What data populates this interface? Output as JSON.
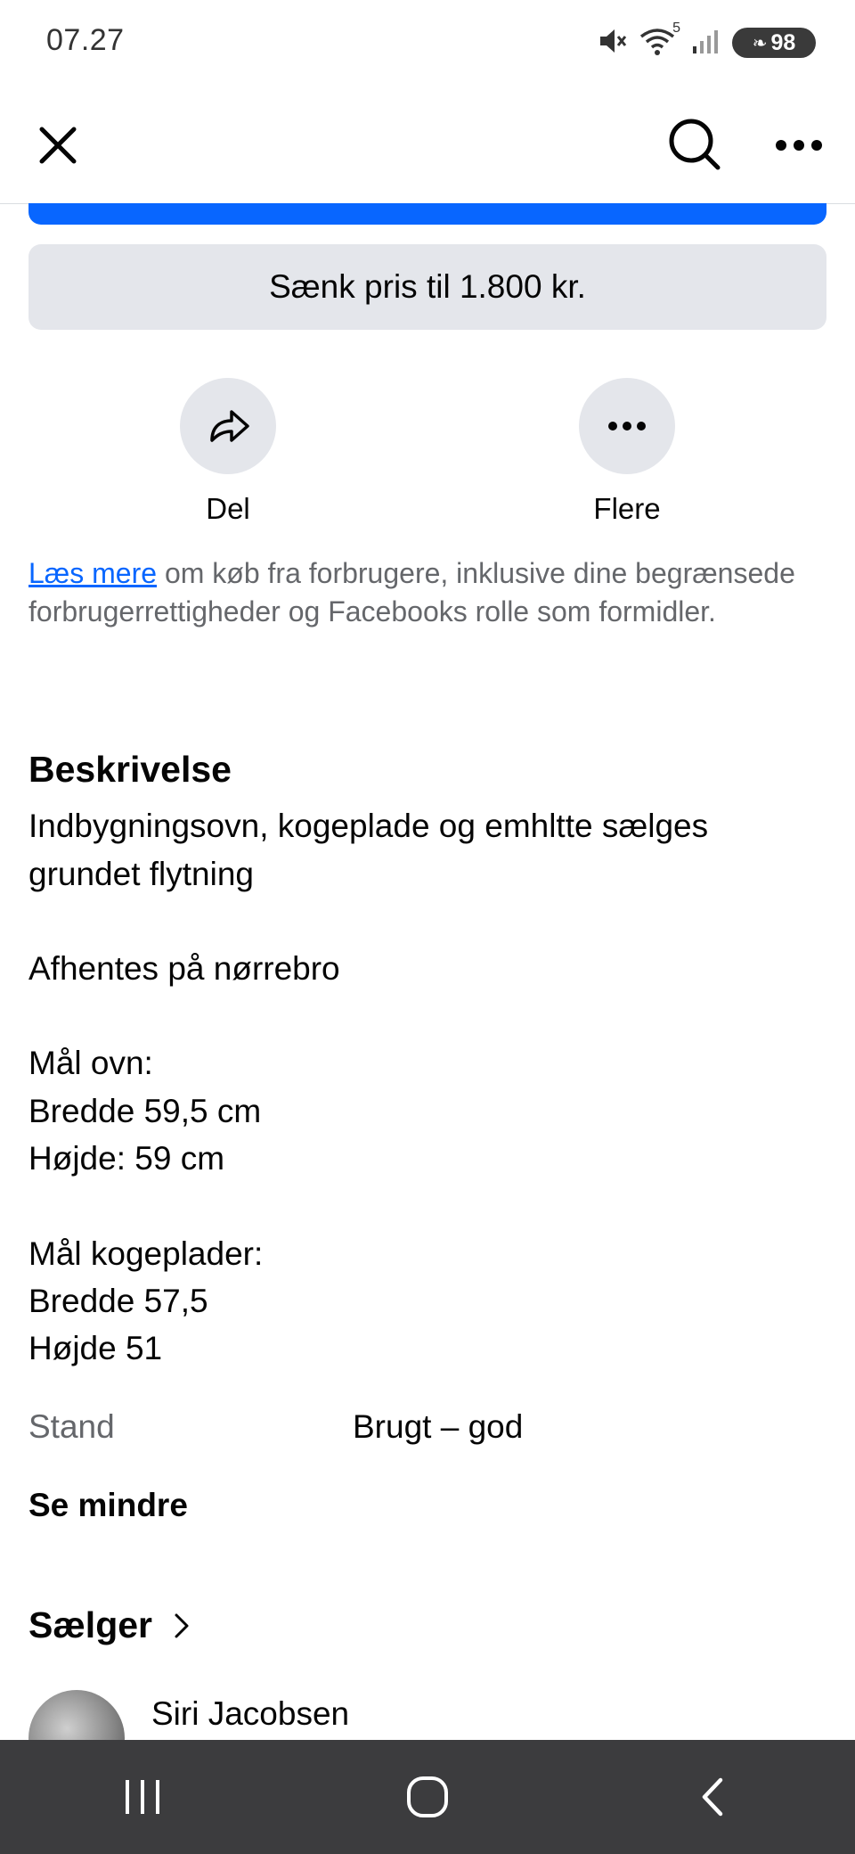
{
  "status_bar": {
    "time": "07.27",
    "battery": "98",
    "wifi_badge": "5"
  },
  "top_nav": {
    "close_icon": "close-icon",
    "search_icon": "search-icon",
    "more_icon": "more-horizontal-icon"
  },
  "actions": {
    "lower_price_label": "Sænk pris til 1.800 kr.",
    "share_label": "Del",
    "more_label": "Flere"
  },
  "legal": {
    "link_text": "Læs mere",
    "text": " om køb fra forbrugere, inklusive dine begrænsede forbrugerrettigheder og Facebooks rolle som formidler."
  },
  "description": {
    "heading": "Beskrivelse",
    "lines": [
      "Indbygningsovn, kogeplade og emhltte sælges",
      "grundet flytning",
      "Afhentes på nørrebro",
      "Mål ovn:",
      "Bredde 59,5 cm",
      "Højde: 59 cm",
      "Mål kogeplader:",
      "Bredde 57,5",
      "Højde 51"
    ],
    "condition_label": "Stand",
    "condition_value": "Brugt – god",
    "see_less": "Se mindre"
  },
  "seller": {
    "heading": "Sælger",
    "name": "Siri Jacobsen"
  },
  "colors": {
    "primary": "#0866ff",
    "secondary_button": "#e4e6eb",
    "muted_text": "#65676b",
    "system_nav": "#3c3c3e"
  }
}
